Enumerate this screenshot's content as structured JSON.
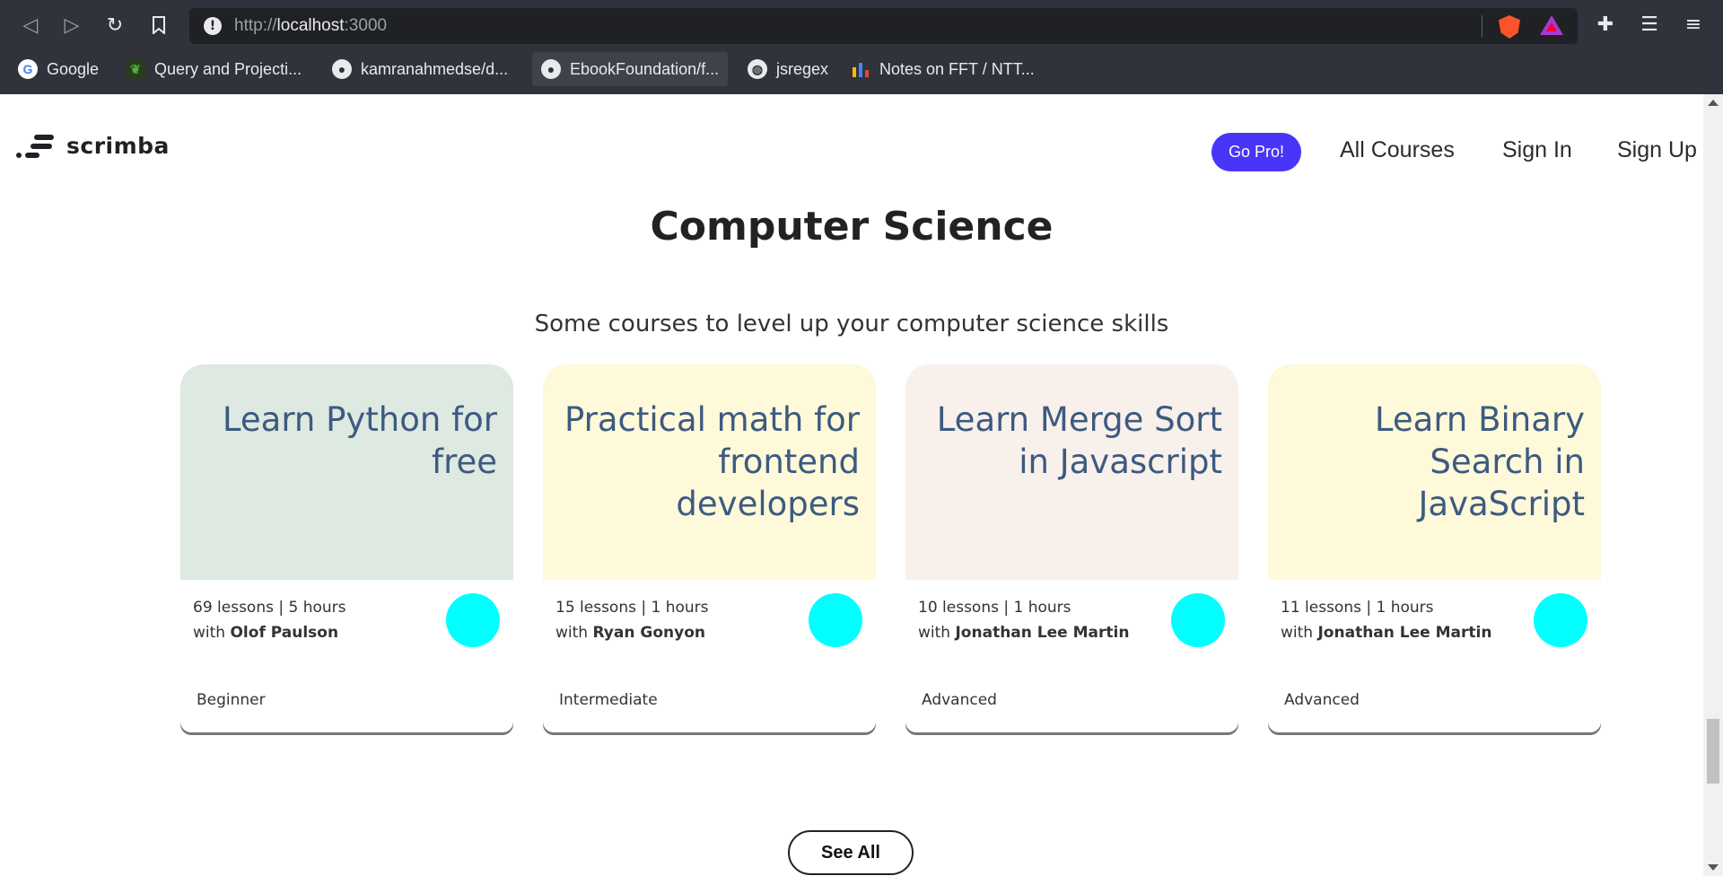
{
  "browser": {
    "url_prefix": "http://",
    "url_host": "localhost",
    "url_port": ":3000",
    "bookmarks": [
      {
        "label": "Google",
        "icon": "google-icon"
      },
      {
        "label": "Query and Projecti...",
        "icon": "mongodb-leaf-icon"
      },
      {
        "label": "kamranahmedse/d...",
        "icon": "github-icon"
      },
      {
        "label": "EbookFoundation/f...",
        "icon": "github-icon"
      },
      {
        "label": "jsregex",
        "icon": "globe-icon"
      },
      {
        "label": "Notes on FFT / NTT...",
        "icon": "bar-chart-icon"
      }
    ]
  },
  "header": {
    "logo_text": "scrimba",
    "go_pro": "Go Pro!",
    "nav": [
      "All Courses",
      "Sign In",
      "Sign Up"
    ]
  },
  "section": {
    "title": "Computer Science",
    "subtitle": "Some courses to level up your computer science skills"
  },
  "courses": [
    {
      "title": "Learn Python for free",
      "lessons": "69 lessons | 5 hours",
      "with": "with",
      "author": "Olof Paulson",
      "level": "Beginner",
      "color": "#dde9e1"
    },
    {
      "title": "Practical math for frontend developers",
      "lessons": "15 lessons | 1 hours",
      "with": "with",
      "author": "Ryan Gonyon",
      "level": "Intermediate",
      "color": "#fdf9d9"
    },
    {
      "title": "Learn Merge Sort in Javascript",
      "lessons": "10 lessons | 1 hours",
      "with": "with",
      "author": "Jonathan Lee Martin",
      "level": "Advanced",
      "color": "#f8f0eb"
    },
    {
      "title": "Learn Binary Search in JavaScript",
      "lessons": "11 lessons | 1 hours",
      "with": "with",
      "author": "Jonathan Lee Martin",
      "level": "Advanced",
      "color": "#fdf9d9"
    }
  ],
  "see_all": "See All",
  "colors": {
    "accent": "#4835f7",
    "avatar": "#00ffff",
    "title_text": "#3d5a80"
  }
}
